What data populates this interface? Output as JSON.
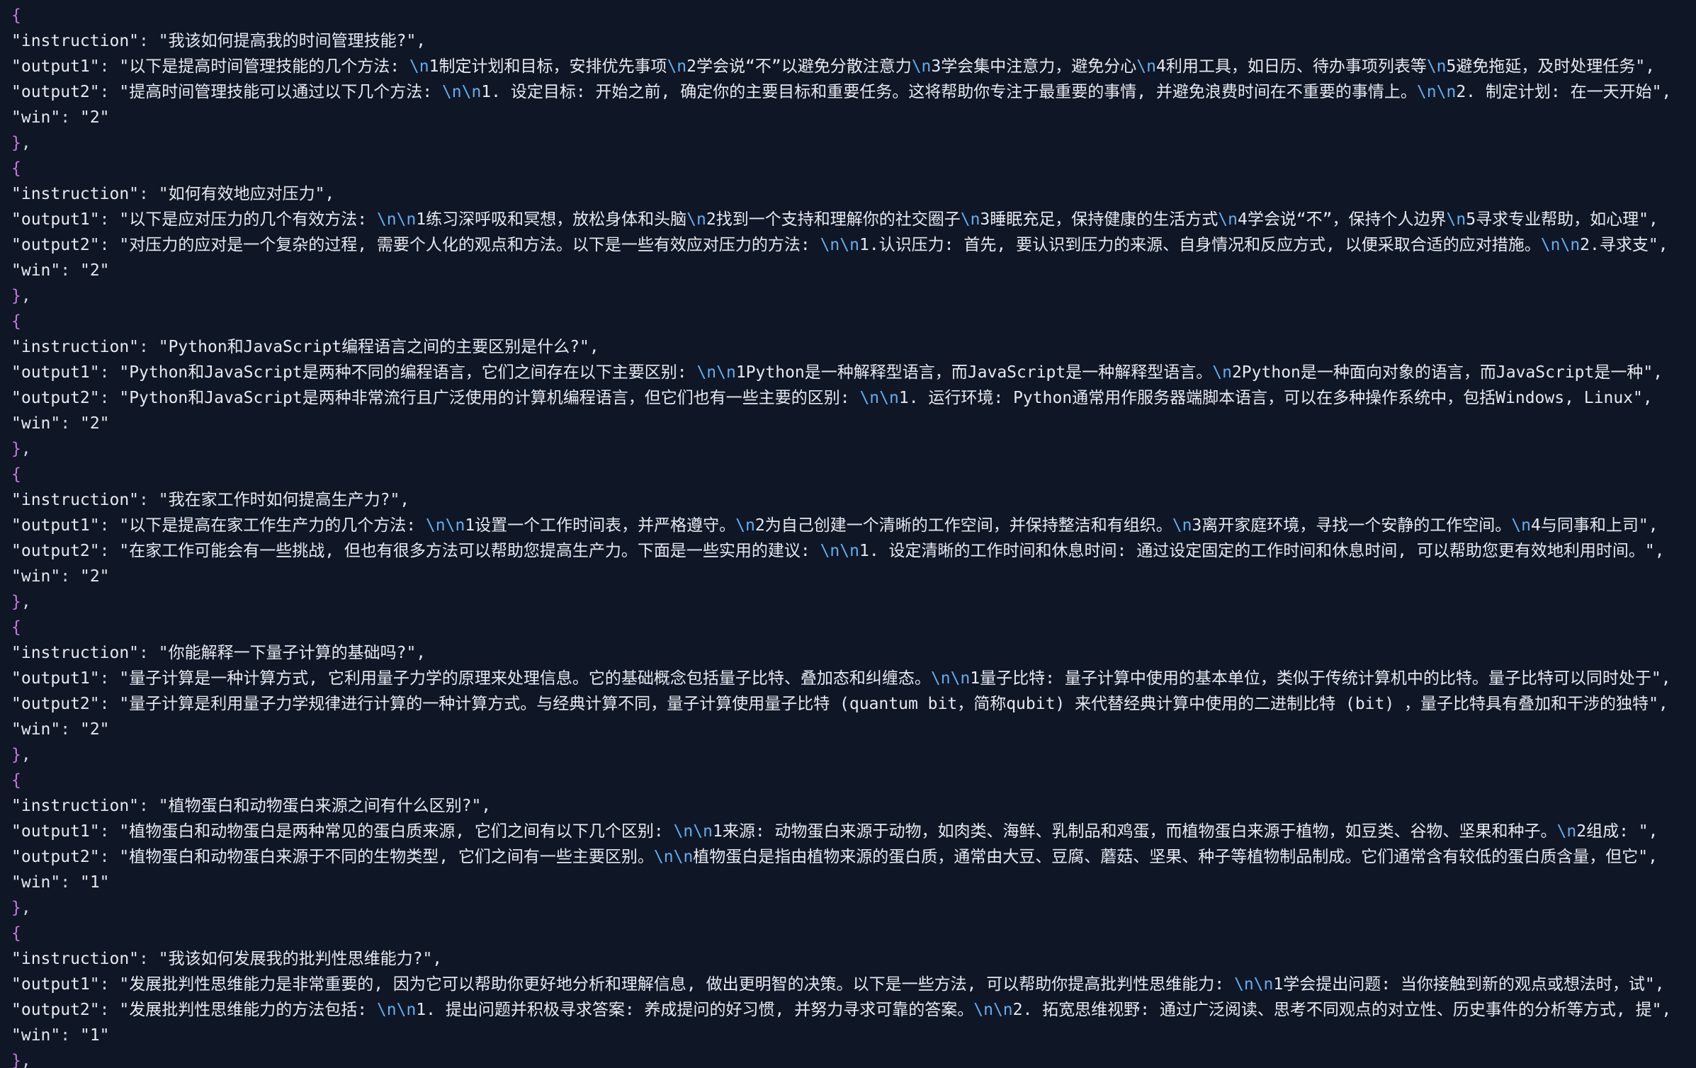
{
  "editor": {
    "records": [
      {
        "instruction": "我该如何提高我的时间管理技能?",
        "output1": "以下是提高时间管理技能的几个方法: \\n1制定计划和目标，安排优先事项\\n2学会说“不”以避免分散注意力\\n3学会集中注意力，避免分心\\n4利用工具，如日历、待办事项列表等\\n5避免拖延，及时处理任务",
        "output2": "提高时间管理技能可以通过以下几个方法: \\n\\n1. 设定目标: 开始之前, 确定你的主要目标和重要任务。这将帮助你专注于最重要的事情, 并避免浪费时间在不重要的事情上。\\n\\n2. 制定计划: 在一天开始",
        "win": "2"
      },
      {
        "instruction": "如何有效地应对压力",
        "output1": "以下是应对压力的几个有效方法: \\n\\n1练习深呼吸和冥想，放松身体和头脑\\n2找到一个支持和理解你的社交圈子\\n3睡眠充足，保持健康的生活方式\\n4学会说“不”，保持个人边界\\n5寻求专业帮助，如心理",
        "output2": "对压力的应对是一个复杂的过程, 需要个人化的观点和方法。以下是一些有效应对压力的方法: \\n\\n1.认识压力: 首先, 要认识到压力的来源、自身情况和反应方式, 以便采取合适的应对措施。\\n\\n2.寻求支",
        "win": "2"
      },
      {
        "instruction": "Python和JavaScript编程语言之间的主要区别是什么?",
        "output1": "Python和JavaScript是两种不同的编程语言，它们之间存在以下主要区别: \\n\\n1Python是一种解释型语言，而JavaScript是一种解释型语言。\\n2Python是一种面向对象的语言，而JavaScript是一种",
        "output2": "Python和JavaScript是两种非常流行且广泛使用的计算机编程语言，但它们也有一些主要的区别: \\n\\n1. 运行环境: Python通常用作服务器端脚本语言，可以在多种操作系统中，包括Windows, Linux",
        "win": "2"
      },
      {
        "instruction": "我在家工作时如何提高生产力?",
        "output1": "以下是提高在家工作生产力的几个方法: \\n\\n1设置一个工作时间表，并严格遵守。\\n2为自己创建一个清晰的工作空间，并保持整洁和有组织。\\n3离开家庭环境，寻找一个安静的工作空间。\\n4与同事和上司",
        "output2": "在家工作可能会有一些挑战, 但也有很多方法可以帮助您提高生产力。下面是一些实用的建议: \\n\\n1. 设定清晰的工作时间和休息时间: 通过设定固定的工作时间和休息时间, 可以帮助您更有效地利用时间。",
        "win": "2"
      },
      {
        "instruction": "你能解释一下量子计算的基础吗?",
        "output1": "量子计算是一种计算方式, 它利用量子力学的原理来处理信息。它的基础概念包括量子比特、叠加态和纠缠态。\\n\\n1量子比特: 量子计算中使用的基本单位，类似于传统计算机中的比特。量子比特可以同时处于",
        "output2": "量子计算是利用量子力学规律进行计算的一种计算方式。与经典计算不同，量子计算使用量子比特 (quantum bit，简称qubit) 来代替经典计算中使用的二进制比特 (bit) ，量子比特具有叠加和干涉的独特",
        "win": "2"
      },
      {
        "instruction": "植物蛋白和动物蛋白来源之间有什么区别?",
        "output1": "植物蛋白和动物蛋白是两种常见的蛋白质来源, 它们之间有以下几个区别: \\n\\n1来源: 动物蛋白来源于动物，如肉类、海鲜、乳制品和鸡蛋，而植物蛋白来源于植物，如豆类、谷物、坚果和种子。\\n2组成: ",
        "output2": "植物蛋白和动物蛋白来源于不同的生物类型, 它们之间有一些主要区别。\\n\\n植物蛋白是指由植物来源的蛋白质，通常由大豆、豆腐、蘑菇、坚果、种子等植物制品制成。它们通常含有较低的蛋白质含量，但它",
        "win": "1"
      },
      {
        "instruction": "我该如何发展我的批判性思维能力?",
        "output1": "发展批判性思维能力是非常重要的, 因为它可以帮助你更好地分析和理解信息, 做出更明智的决策。以下是一些方法, 可以帮助你提高批判性思维能力: \\n\\n1学会提出问题: 当你接触到新的观点或想法时，试",
        "output2": "发展批判性思维能力的方法包括: \\n\\n1. 提出问题并积极寻求答案: 养成提问的好习惯, 并努力寻求可靠的答案。\\n\\n2. 拓宽思维视野: 通过广泛阅读、思考不同观点的对立性、历史事件的分析等方式, 提",
        "win": "1"
      }
    ]
  }
}
